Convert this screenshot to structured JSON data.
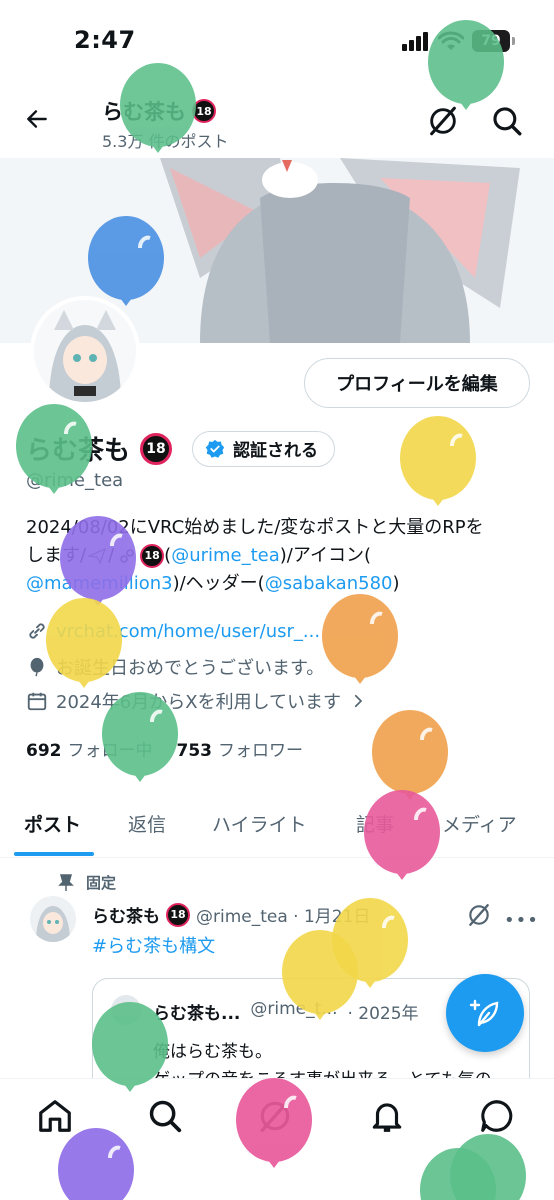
{
  "status": {
    "time": "2:47",
    "battery": "79"
  },
  "header": {
    "name": "らむ茶も",
    "badge": "18",
    "post_count": "5.3万 件のポスト"
  },
  "profile": {
    "edit_label": "プロフィールを編集",
    "display_name": "らむ茶も",
    "verify_label": "認証される",
    "handle": "@rime_tea",
    "bio_line1": "2024/08/02にVRC始めました/変なポストと大量のRPを",
    "bio_line2_a": "します/",
    "bio_line2_b": "(",
    "bio_link1": "@urime_tea",
    "bio_line2_c": ")/アイコン(",
    "bio_link2": "@mamemillion3",
    "bio_line3_a": ")/ヘッダー(",
    "bio_link3": "@sabakan580",
    "bio_line3_b": ")",
    "website": "vrchat.com/home/user/usr_...",
    "birthday": "お誕生日おめでとうございます。",
    "joined": "2024年6月からXを利用しています",
    "following_count": "692",
    "following_label": "フォロー中",
    "followers_count": "753",
    "followers_label": "フォロワー"
  },
  "tabs": [
    "ポスト",
    "返信",
    "ハイライト",
    "記事",
    "メディア"
  ],
  "post": {
    "pinned_label": "固定",
    "name": "らむ茶も",
    "handle_date": "@rime_tea · 1月21日",
    "hashtag": "#らむ茶も構文",
    "quote_name": "らむ茶も...",
    "quote_handle": "@rime_t...",
    "quote_date": "· 2025年",
    "quote_line1": "俺はらむ茶も。",
    "quote_line2": "ゲップの音をころす事が出来る。とても気の"
  },
  "colors": {
    "accent": "#1d9bf0",
    "text": "#0f1419",
    "muted": "#536471"
  }
}
